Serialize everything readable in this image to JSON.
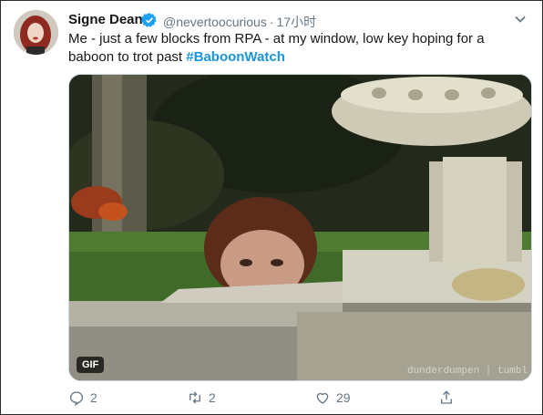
{
  "tweet": {
    "author_name": "Signe Dean",
    "handle": "@nevertoocurious",
    "separator": "·",
    "time": "17小时",
    "text_main": "Me - just a few blocks from RPA - at my window, low key hoping for a baboon to trot past ",
    "hashtag": "#BaboonWatch"
  },
  "media": {
    "badge": "GIF",
    "watermark": "dunderdumpen | tumbl"
  },
  "actions": {
    "reply_count": "2",
    "retweet_count": "2",
    "like_count": "29"
  },
  "colors": {
    "accent": "#1b95e0",
    "muted": "#657786"
  }
}
